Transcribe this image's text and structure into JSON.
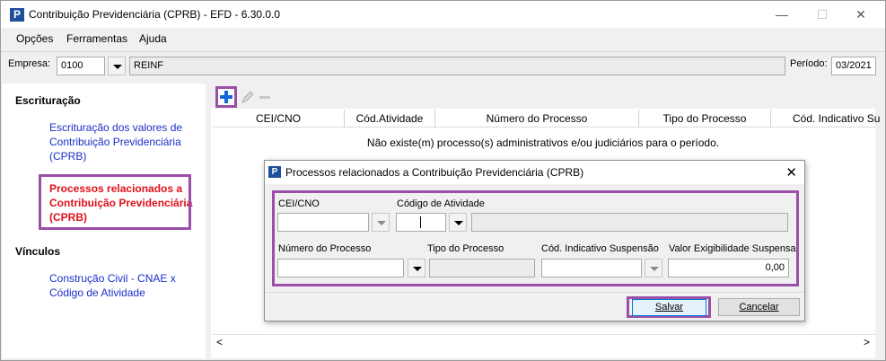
{
  "window": {
    "title": "Contribuição Previdenciária (CPRB)  -  EFD - 6.30.0.0",
    "app_icon": "P",
    "controls": {
      "minimize": "—",
      "maximize": "☐",
      "close": "✕"
    }
  },
  "menu": [
    "Opções",
    "Ferramentas",
    "Ajuda"
  ],
  "empresa": {
    "label": "Empresa:",
    "code": "0100",
    "name": "REINF"
  },
  "periodo": {
    "label": "Período:",
    "value": "03/2021"
  },
  "sidebar": {
    "sections": [
      {
        "title": "Escrituração",
        "items": [
          {
            "label": "Escrituração dos valores de Contribuição Previdenciária (CPRB)",
            "active": false
          },
          {
            "label": "Processos relacionados a Contribuição Previdenciária (CPRB)",
            "active": true
          }
        ]
      },
      {
        "title": "Vínculos",
        "items": [
          {
            "label": "Construção Civil - CNAE x Código de Atividade",
            "active": false
          }
        ]
      }
    ]
  },
  "toolbar": {
    "add_icon": "plus-icon",
    "edit_icon": "pencil-icon",
    "remove_icon": "minus-icon"
  },
  "grid": {
    "columns": [
      "CEI/CNO",
      "Cód.Atividade",
      "Número do Processo",
      "Tipo do Processo",
      "Cód. Indicativo Su"
    ],
    "empty_message": "Não existe(m) processo(s) administrativos e/ou judiciários para o período."
  },
  "dialog": {
    "title": "Processos relacionados a Contribuição Previdenciária (CPRB)",
    "fields": {
      "cei_cno": {
        "label": "CEI/CNO",
        "value": ""
      },
      "codigo_atividade": {
        "label": "Código de Atividade",
        "value": ""
      },
      "numero_processo": {
        "label": "Número do Processo",
        "value": ""
      },
      "tipo_processo": {
        "label": "Tipo do Processo",
        "value": ""
      },
      "cod_indicativo": {
        "label": "Cód. Indicativo Suspensão",
        "value": ""
      },
      "valor_exigibilidade": {
        "label": "Valor Exigibilidade Suspensa",
        "value": "0,00"
      }
    },
    "buttons": {
      "save": "Salvar",
      "cancel": "Cancelar"
    }
  },
  "colors": {
    "highlight": "#9b4fa8",
    "link": "#1a2fc9",
    "active_link": "#e0101b",
    "brand": "#1e4f9c"
  }
}
